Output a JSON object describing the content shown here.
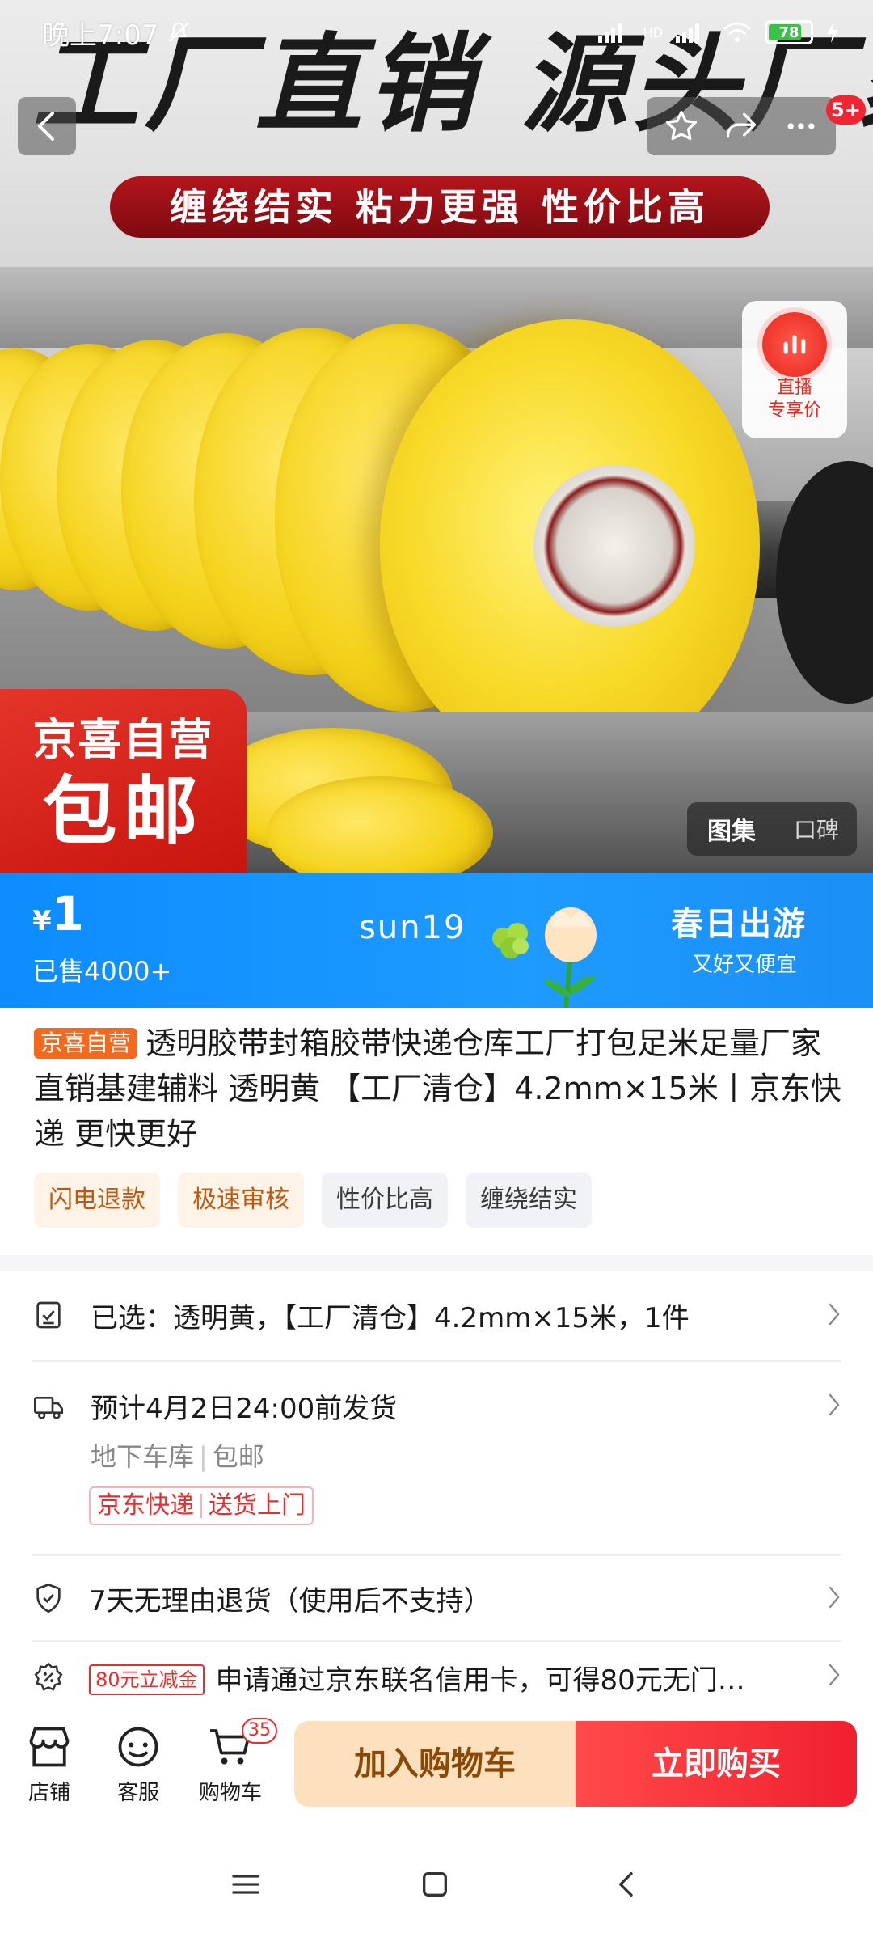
{
  "status_bar": {
    "time": "晚上7:07",
    "battery": "78",
    "signal_label": "HD"
  },
  "hero": {
    "banner_headline": "工厂直销 源头厂家",
    "banner_ribbon": "缠绕结实 粘力更强 性价比高",
    "badge_count": "5+",
    "live_label_1": "直播",
    "live_label_2": "专享价",
    "self_badge_line1": "京喜自营",
    "self_badge_line2": "包邮",
    "gallery_tabs": [
      "图集",
      "口碑"
    ]
  },
  "price_banner": {
    "currency": "¥",
    "price": "1",
    "sold": "已售4000+",
    "promo_code": "sun19",
    "spring_title": "春日出游",
    "spring_sub": "又好又便宜"
  },
  "product": {
    "self_tag": "京喜自营",
    "title": "透明胶带封箱胶带快递仓库工厂打包足米足量厂家直销基建辅料 透明黄 【工厂清仓】4.2mm×15米丨京东快递 更快更好",
    "tags": [
      "闪电退款",
      "极速审核",
      "性价比高",
      "缠绕结实"
    ]
  },
  "details": {
    "selected": "已选：透明黄，【工厂清仓】4.2mm×15米，1件",
    "delivery_estimate": "预计4月2日24:00前发货",
    "delivery_location": "地下车库",
    "delivery_free": "包邮",
    "express_1": "京东快递",
    "express_2": "送货上门",
    "return_policy": "7天无理由退货（使用后不支持）",
    "coupon_tag": "80元立减金",
    "coupon_text": "申请通过京东联名信用卡，可得80元无门…"
  },
  "bottom_bar": {
    "store": "店铺",
    "service": "客服",
    "cart": "购物车",
    "cart_count": "35",
    "add_to_cart": "加入购物车",
    "buy_now": "立即购买"
  },
  "colors": {
    "accent_red": "#f0202f",
    "accent_blue": "#1e9bff",
    "tag_orange": "#f36a1f"
  }
}
